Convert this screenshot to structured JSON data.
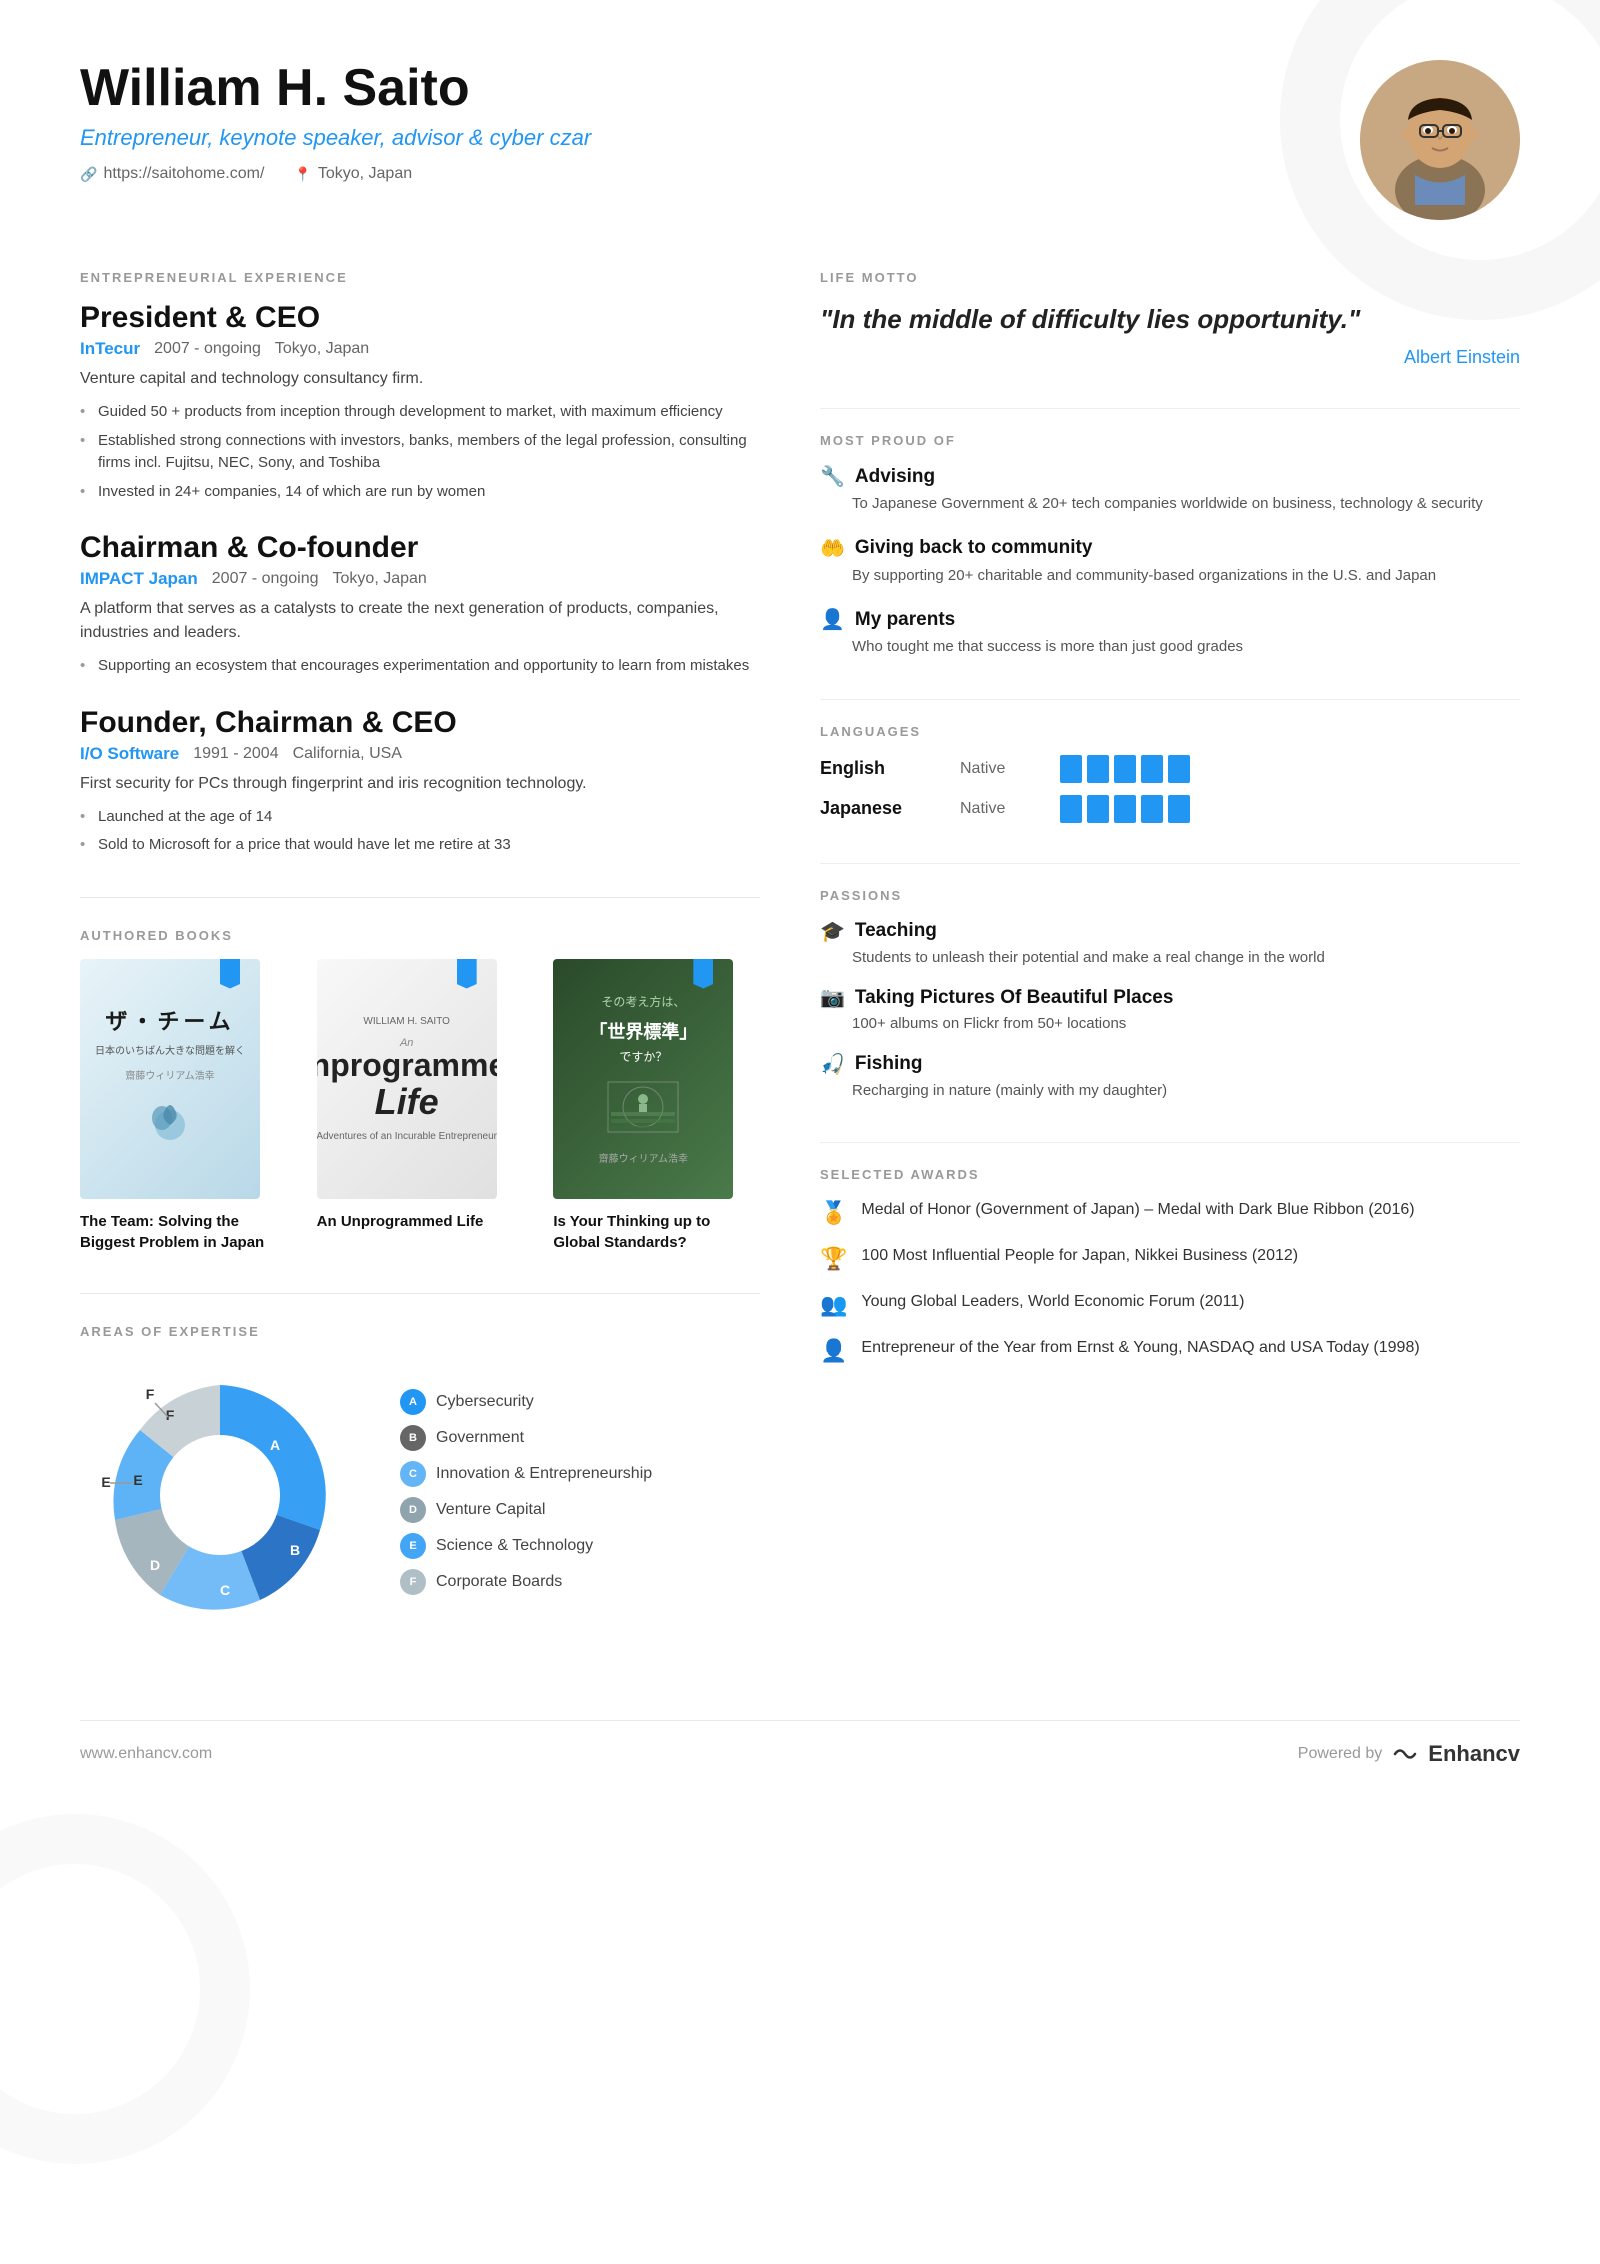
{
  "header": {
    "name": "William H. Saito",
    "title": "Entrepreneur, keynote speaker, advisor & cyber czar",
    "website": "https://saitohome.com/",
    "location": "Tokyo, Japan"
  },
  "left": {
    "experience_label": "ENTREPRENEURIAL EXPERIENCE",
    "jobs": [
      {
        "title": "President & CEO",
        "company": "InTecur",
        "dates": "2007 - ongoing",
        "location": "Tokyo, Japan",
        "description": "Venture capital and technology consultancy firm.",
        "bullets": [
          "Guided 50 + products from inception through development to market, with maximum efficiency",
          "Established strong connections with investors, banks, members of the legal profession, consulting firms incl. Fujitsu, NEC, Sony, and Toshiba",
          "Invested in 24+ companies, 14 of which are run by women"
        ]
      },
      {
        "title": "Chairman & Co-founder",
        "company": "IMPACT Japan",
        "dates": "2007 - ongoing",
        "location": "Tokyo, Japan",
        "description": "A platform that serves as a catalysts to create the next generation of products, companies, industries and leaders.",
        "bullets": [
          "Supporting an ecosystem that encourages experimentation and opportunity to learn from mistakes"
        ]
      },
      {
        "title": "Founder, Chairman & CEO",
        "company": "I/O Software",
        "dates": "1991 - 2004",
        "location": "California, USA",
        "description": "First security for PCs through fingerprint and iris recognition technology.",
        "bullets": [
          "Launched at the age of 14",
          "Sold to Microsoft for a price that would have let me retire at 33"
        ]
      }
    ],
    "books_label": "AUTHORED BOOKS",
    "books": [
      {
        "title": "The Team: Solving the Biggest Problem in Japan"
      },
      {
        "title": "An Unprogrammed Life"
      },
      {
        "title": "Is Your Thinking up to Global Standards?"
      }
    ],
    "expertise_label": "AREAS OF EXPERTISE",
    "expertise_items": [
      {
        "letter": "A",
        "label": "Cybersecurity"
      },
      {
        "letter": "B",
        "label": "Government"
      },
      {
        "letter": "C",
        "label": "Innovation & Entrepreneurship"
      },
      {
        "letter": "D",
        "label": "Venture Capital"
      },
      {
        "letter": "E",
        "label": "Science & Technology"
      },
      {
        "letter": "F",
        "label": "Corporate Boards"
      }
    ]
  },
  "right": {
    "motto_label": "LIFE MOTTO",
    "motto_text": "\"In the middle of difficulty lies opportunity.\"",
    "motto_author": "Albert Einstein",
    "proud_label": "MOST PROUD OF",
    "proud_items": [
      {
        "icon": "🔧",
        "title": "Advising",
        "desc": "To Japanese Government & 20+ tech companies worldwide on business, technology & security"
      },
      {
        "icon": "🤲",
        "title": "Giving back to community",
        "desc": "By supporting 20+ charitable and community-based organizations in the U.S. and Japan"
      },
      {
        "icon": "👤",
        "title": "My parents",
        "desc": "Who tought me that success is more than just good grades"
      }
    ],
    "languages_label": "LANGUAGES",
    "languages": [
      {
        "name": "English",
        "level": "Native",
        "bars": 5
      },
      {
        "name": "Japanese",
        "level": "Native",
        "bars": 5
      }
    ],
    "passions_label": "PASSIONS",
    "passions": [
      {
        "icon": "🎓",
        "title": "Teaching",
        "desc": "Students to unleash their potential and make a real change in the world"
      },
      {
        "icon": "📷",
        "title": "Taking Pictures Of Beautiful Places",
        "desc": "100+ albums on Flickr from 50+ locations"
      },
      {
        "icon": "🎣",
        "title": "Fishing",
        "desc": "Recharging in nature (mainly with my daughter)"
      }
    ],
    "awards_label": "SELECTED AWARDS",
    "awards": [
      {
        "icon": "🏅",
        "text": "Medal of Honor (Government of Japan) – Medal with Dark Blue Ribbon (2016)"
      },
      {
        "icon": "🏆",
        "text": "100 Most Influential People for Japan, Nikkei Business (2012)"
      },
      {
        "icon": "👥",
        "text": "Young Global Leaders, World Economic Forum (2011)"
      },
      {
        "icon": "👤",
        "text": "Entrepreneur of the Year from Ernst & Young, NASDAQ and USA Today (1998)"
      }
    ]
  },
  "footer": {
    "url": "www.enhancv.com",
    "powered_by": "Powered by",
    "brand": "Enhancv"
  }
}
